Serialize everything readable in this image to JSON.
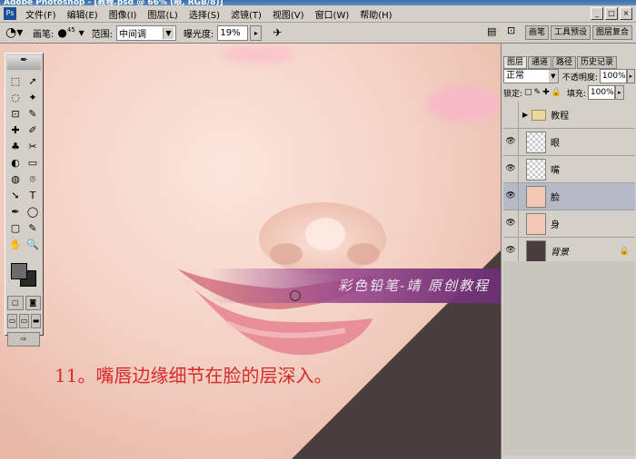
{
  "window": {
    "title": "Adobe Photoshop - [教程.psd @ 66% (眼, RGB/8)]",
    "controls": [
      "_",
      "□",
      "×"
    ]
  },
  "menu": {
    "app_icon": "ps-logo-icon",
    "items": [
      "文件(F)",
      "编辑(E)",
      "图像(I)",
      "图层(L)",
      "选择(S)",
      "滤镜(T)",
      "视图(V)",
      "窗口(W)",
      "帮助(H)"
    ],
    "doc_controls": [
      "_",
      "□",
      "×"
    ]
  },
  "options": {
    "tool_icon": "dodge-tool-icon",
    "brush_label": "画笔:",
    "brush_size": "45",
    "range_label": "范围:",
    "range_value": "中间调",
    "exposure_label": "曝光度:",
    "exposure_value": "19%",
    "palette_tabs": [
      "画笔",
      "工具预设",
      "图层复合"
    ]
  },
  "toolbox": {
    "tools": [
      "⬚",
      "➚",
      "◌",
      "✦",
      "⊡",
      "✎",
      "✚",
      "✐",
      "♣",
      "✂",
      "◐",
      "▭",
      "◍",
      "⌾",
      "➘",
      "T",
      "✒",
      "◯",
      "▢",
      "✎",
      "✋",
      "🔍"
    ]
  },
  "canvas": {
    "banner_text": "彩色铅笔-靖 原创教程",
    "caption": "11。嘴唇边缘细节在脸的层深入。"
  },
  "layers_panel": {
    "tabs": [
      "图层",
      "通道",
      "路径",
      "历史记录"
    ],
    "blend_mode": "正常",
    "opacity_label": "不透明度:",
    "opacity_value": "100%",
    "lock_label": "锁定:",
    "fill_label": "填充:",
    "fill_value": "100%",
    "layers": [
      {
        "name": "教程",
        "type": "folder",
        "visible": false,
        "selected": false
      },
      {
        "name": "眼",
        "type": "layer",
        "visible": true,
        "selected": false
      },
      {
        "name": "嘴",
        "type": "layer",
        "visible": true,
        "selected": false
      },
      {
        "name": "脸",
        "type": "layer",
        "visible": true,
        "selected": true
      },
      {
        "name": "身",
        "type": "layer",
        "visible": true,
        "selected": false
      },
      {
        "name": "背景",
        "type": "background",
        "visible": true,
        "selected": false
      }
    ]
  },
  "colors": {
    "foreground": "#6b6b6b",
    "background": "#2a2a2a",
    "caption_color": "#d62a2a",
    "selected_layer": "#b6bac7"
  }
}
